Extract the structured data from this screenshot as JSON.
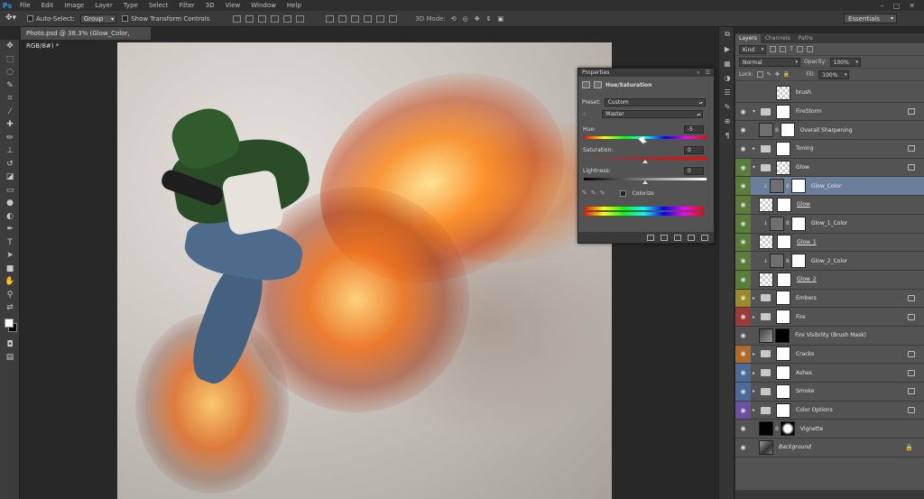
{
  "app": {
    "logo": "Ps"
  },
  "menu": [
    "File",
    "Edit",
    "Image",
    "Layer",
    "Type",
    "Select",
    "Filter",
    "3D",
    "View",
    "Window",
    "Help"
  ],
  "window_controls": [
    "–",
    "□",
    "✕"
  ],
  "options_bar": {
    "auto_select_label": "Auto-Select:",
    "auto_select_value": "Group",
    "transform_label": "Show Transform Controls",
    "mode_3d_label": "3D Mode:",
    "workspace": "Essentials"
  },
  "document": {
    "tab_title": "Photo.psd @ 38.3% (Glow_Color, RGB/8#) *",
    "close": "×"
  },
  "properties": {
    "title": "Properties",
    "adjustment": "Hue/Saturation",
    "preset_label": "Preset:",
    "preset_value": "Custom",
    "channel_value": "Master",
    "hue_label": "Hue:",
    "hue_value": "-5",
    "saturation_label": "Saturation:",
    "saturation_value": "0",
    "lightness_label": "Lightness:",
    "lightness_value": "0",
    "colorize_label": "Colorize"
  },
  "layers_panel": {
    "tabs": [
      "Layers",
      "Channels",
      "Paths"
    ],
    "kind_label": "Kind",
    "blend_mode": "Normal",
    "opacity_label": "Opacity:",
    "opacity_value": "100%",
    "lock_label": "Lock:",
    "fill_label": "Fill:",
    "fill_value": "100%",
    "layers": [
      {
        "name": "brush"
      },
      {
        "name": "FireStorm"
      },
      {
        "name": "Overall Sharpening"
      },
      {
        "name": "Toning"
      },
      {
        "name": "Glow"
      },
      {
        "name": "Glow_Color"
      },
      {
        "name": "Glow"
      },
      {
        "name": "Glow_1_Color"
      },
      {
        "name": "Glow_1"
      },
      {
        "name": "Glow_2_Color"
      },
      {
        "name": "Glow_2"
      },
      {
        "name": "Embers"
      },
      {
        "name": "Fire"
      },
      {
        "name": "Fire Visibility (Brush Mask)"
      },
      {
        "name": "Cracks"
      },
      {
        "name": "Ashes"
      },
      {
        "name": "Smoke"
      },
      {
        "name": "Color Options"
      },
      {
        "name": "Vignette"
      },
      {
        "name": "Background"
      }
    ]
  },
  "colors": {
    "accent": "#2e8fe0",
    "selected_layer": "#6b7f9b"
  }
}
